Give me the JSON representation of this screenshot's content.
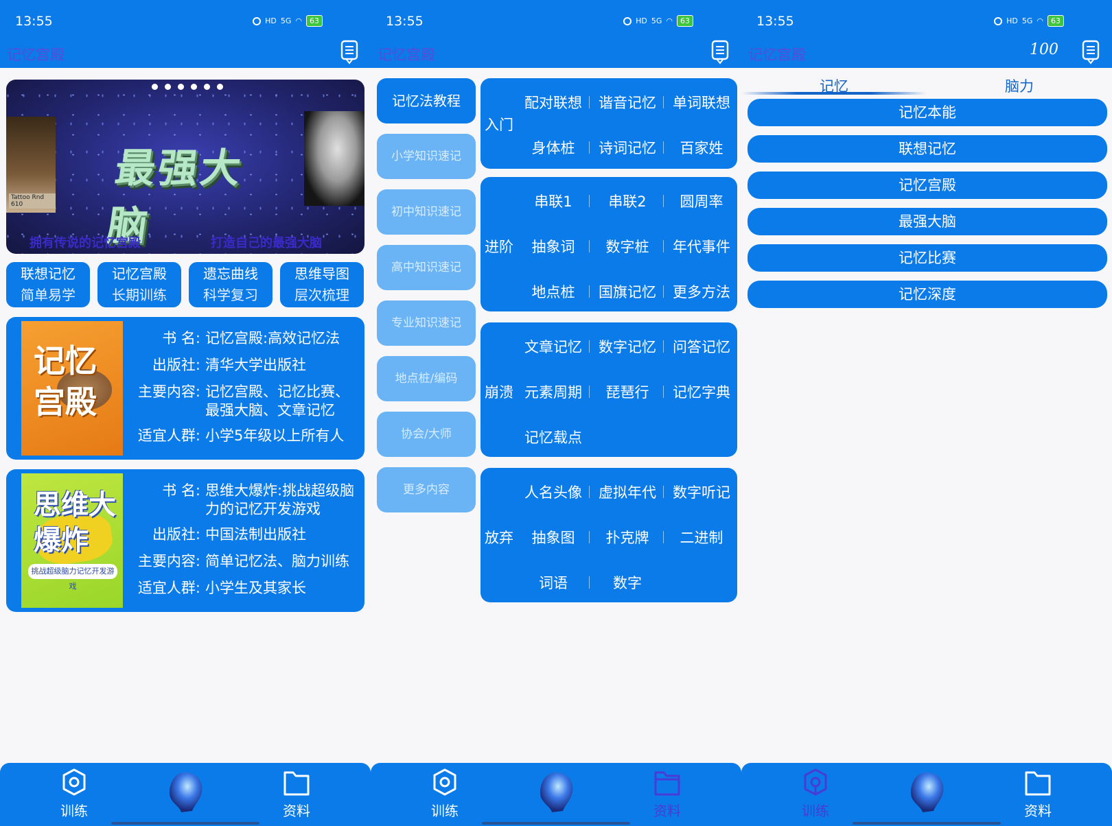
{
  "status": {
    "time": "13:55",
    "battery": "63",
    "signal": "5G",
    "hd": "HD"
  },
  "app_title": "记忆宫殿",
  "bottom_nav": {
    "left_label": "训练",
    "right_label": "资料"
  },
  "panel1": {
    "banner": {
      "caption_left": "拥有传说的记忆宫殿",
      "caption_right": "打造自己的最强大脑",
      "logo_text": "最强大脑",
      "poster_tag": "Tattoo Rnd 610"
    },
    "features": [
      {
        "title": "联想记忆",
        "sub": "简单易学"
      },
      {
        "title": "记忆宫殿",
        "sub": "长期训练"
      },
      {
        "title": "遗忘曲线",
        "sub": "科学复习"
      },
      {
        "title": "思维导图",
        "sub": "层次梳理"
      }
    ],
    "books": [
      {
        "cover_title": "记忆宫殿",
        "labels": {
          "name": "书  名:",
          "publisher": "出版社:",
          "content": "主要内容:",
          "audience": "适宜人群:"
        },
        "name": "记忆宫殿:高效记忆法",
        "publisher": "清华大学出版社",
        "content": "记忆宫殿、记忆比赛、最强大脑、文章记忆",
        "audience": "小学5年级以上所有人"
      },
      {
        "cover_title": "思维大爆炸",
        "cover_band": "挑战超级脑力记忆开发游戏",
        "labels": {
          "name": "书  名:",
          "publisher": "出版社:",
          "content": "主要内容:",
          "audience": "适宜人群:"
        },
        "name": "思维大爆炸:挑战超级脑力的记忆开发游戏",
        "publisher": "中国法制出版社",
        "content": "简单记忆法、脑力训练",
        "audience": "小学生及其家长"
      }
    ]
  },
  "panel2": {
    "side_menu": [
      "记忆法教程",
      "小学知识速记",
      "初中知识速记",
      "高中知识速记",
      "专业知识速记",
      "地点桩/编码",
      "协会/大师",
      "更多内容"
    ],
    "cards": [
      {
        "level": "入门",
        "items": [
          "配对联想",
          "谐音记忆",
          "单词联想",
          "身体桩",
          "诗词记忆",
          "百家姓"
        ]
      },
      {
        "level": "进阶",
        "items": [
          "串联1",
          "串联2",
          "圆周率",
          "抽象词",
          "数字桩",
          "年代事件",
          "地点桩",
          "国旗记忆",
          "更多方法"
        ]
      },
      {
        "level": "崩溃",
        "items": [
          "文章记忆",
          "数字记忆",
          "问答记忆",
          "元素周期",
          "琵琶行",
          "记忆字典",
          "记忆载点"
        ]
      },
      {
        "level": "放弃",
        "items": [
          "人名头像",
          "虚拟年代",
          "数字听记",
          "抽象图",
          "扑克牌",
          "二进制",
          "词语",
          "数字"
        ]
      }
    ]
  },
  "panel3": {
    "header_badge": "100",
    "tabs": [
      "记忆",
      "脑力"
    ],
    "buttons": [
      "记忆本能",
      "联想记忆",
      "记忆宫殿",
      "最强大脑",
      "记忆比赛",
      "记忆深度"
    ]
  },
  "colors": {
    "primary": "#0a7be8",
    "light": "#6ab4f6",
    "title": "#5a4bd8",
    "active_nav": "#4a3ad8"
  }
}
